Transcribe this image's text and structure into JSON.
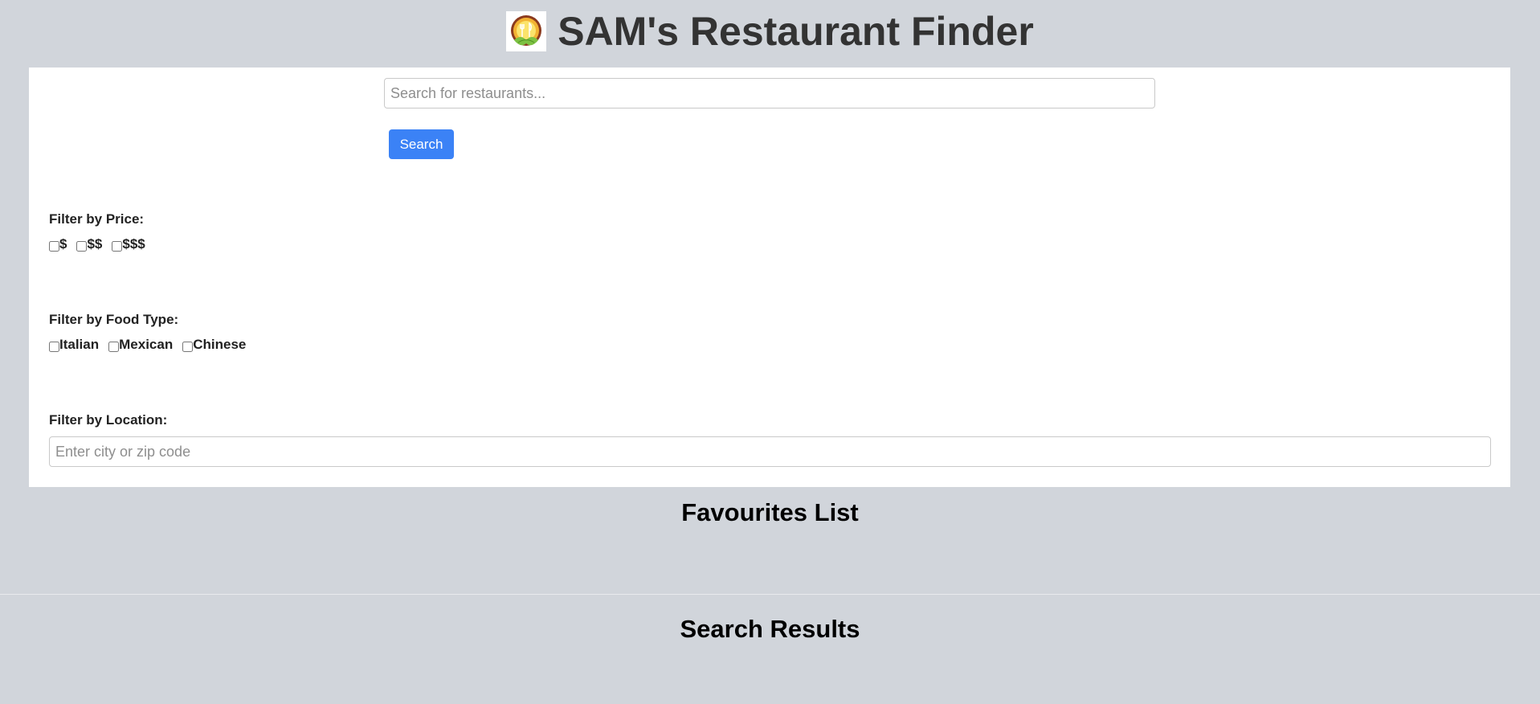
{
  "header": {
    "title": "SAM's Restaurant Finder",
    "logo_icon": "restaurant-logo"
  },
  "search": {
    "placeholder": "Search for restaurants...",
    "value": "",
    "button_label": "Search"
  },
  "filters": {
    "price": {
      "label": "Filter by Price:",
      "options": [
        {
          "label": "$",
          "checked": false
        },
        {
          "label": "$$",
          "checked": false
        },
        {
          "label": "$$$",
          "checked": false
        }
      ]
    },
    "food_type": {
      "label": "Filter by Food Type:",
      "options": [
        {
          "label": "Italian",
          "checked": false
        },
        {
          "label": "Mexican",
          "checked": false
        },
        {
          "label": "Chinese",
          "checked": false
        }
      ]
    },
    "location": {
      "label": "Filter by Location:",
      "placeholder": "Enter city or zip code",
      "value": ""
    }
  },
  "sections": {
    "favourites_title": "Favourites List",
    "results_title": "Search Results"
  },
  "colors": {
    "background": "#d1d5db",
    "panel": "#ffffff",
    "accent": "#3b82f6",
    "title_text": "#333333"
  }
}
